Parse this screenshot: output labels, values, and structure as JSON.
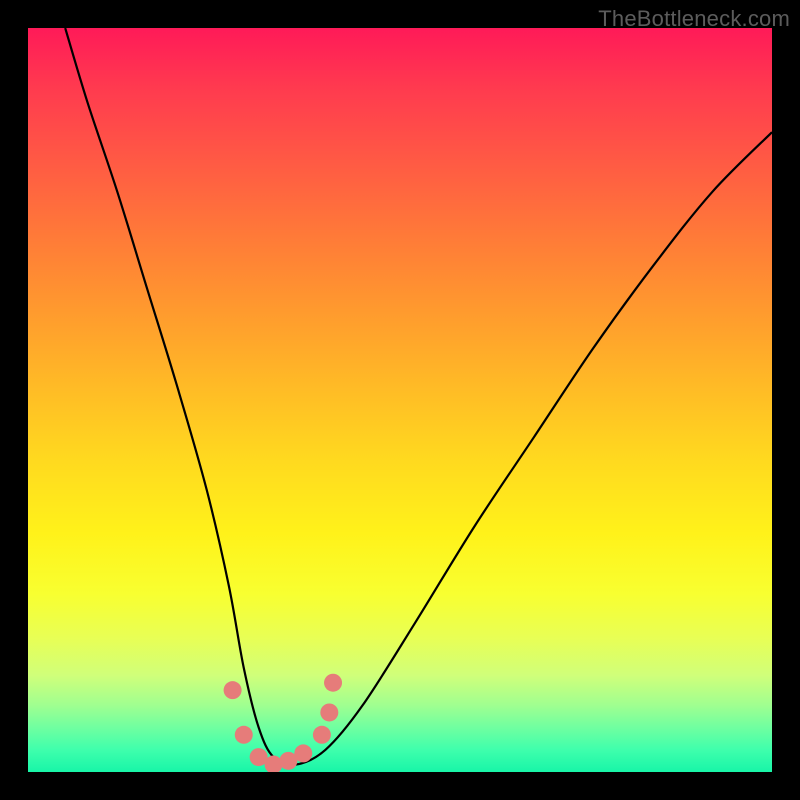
{
  "watermark": "TheBottleneck.com",
  "chart_data": {
    "type": "line",
    "title": "",
    "xlabel": "",
    "ylabel": "",
    "xlim": [
      0,
      100
    ],
    "ylim": [
      0,
      100
    ],
    "grid": false,
    "legend": false,
    "series": [
      {
        "name": "bottleneck-curve",
        "x": [
          5,
          8,
          12,
          16,
          20,
          24,
          27,
          29,
          31,
          33,
          36,
          40,
          45,
          52,
          60,
          68,
          76,
          84,
          92,
          100
        ],
        "values": [
          100,
          90,
          78,
          65,
          52,
          38,
          25,
          14,
          6,
          2,
          1,
          3,
          9,
          20,
          33,
          45,
          57,
          68,
          78,
          86
        ]
      }
    ],
    "markers": {
      "name": "optimal-range-dots",
      "color": "#e67c7a",
      "points": [
        {
          "x": 27.5,
          "y": 11
        },
        {
          "x": 29.0,
          "y": 5
        },
        {
          "x": 31.0,
          "y": 2
        },
        {
          "x": 33.0,
          "y": 1
        },
        {
          "x": 35.0,
          "y": 1.5
        },
        {
          "x": 37.0,
          "y": 2.5
        },
        {
          "x": 39.5,
          "y": 5
        },
        {
          "x": 40.5,
          "y": 8
        },
        {
          "x": 41.0,
          "y": 12
        }
      ]
    },
    "background_gradient": {
      "direction": "top-to-bottom",
      "stops": [
        {
          "pos": 0.0,
          "color": "#ff1a58"
        },
        {
          "pos": 0.35,
          "color": "#ff8a30"
        },
        {
          "pos": 0.65,
          "color": "#fff020"
        },
        {
          "pos": 0.9,
          "color": "#90ff90"
        },
        {
          "pos": 1.0,
          "color": "#18f5a8"
        }
      ]
    }
  }
}
